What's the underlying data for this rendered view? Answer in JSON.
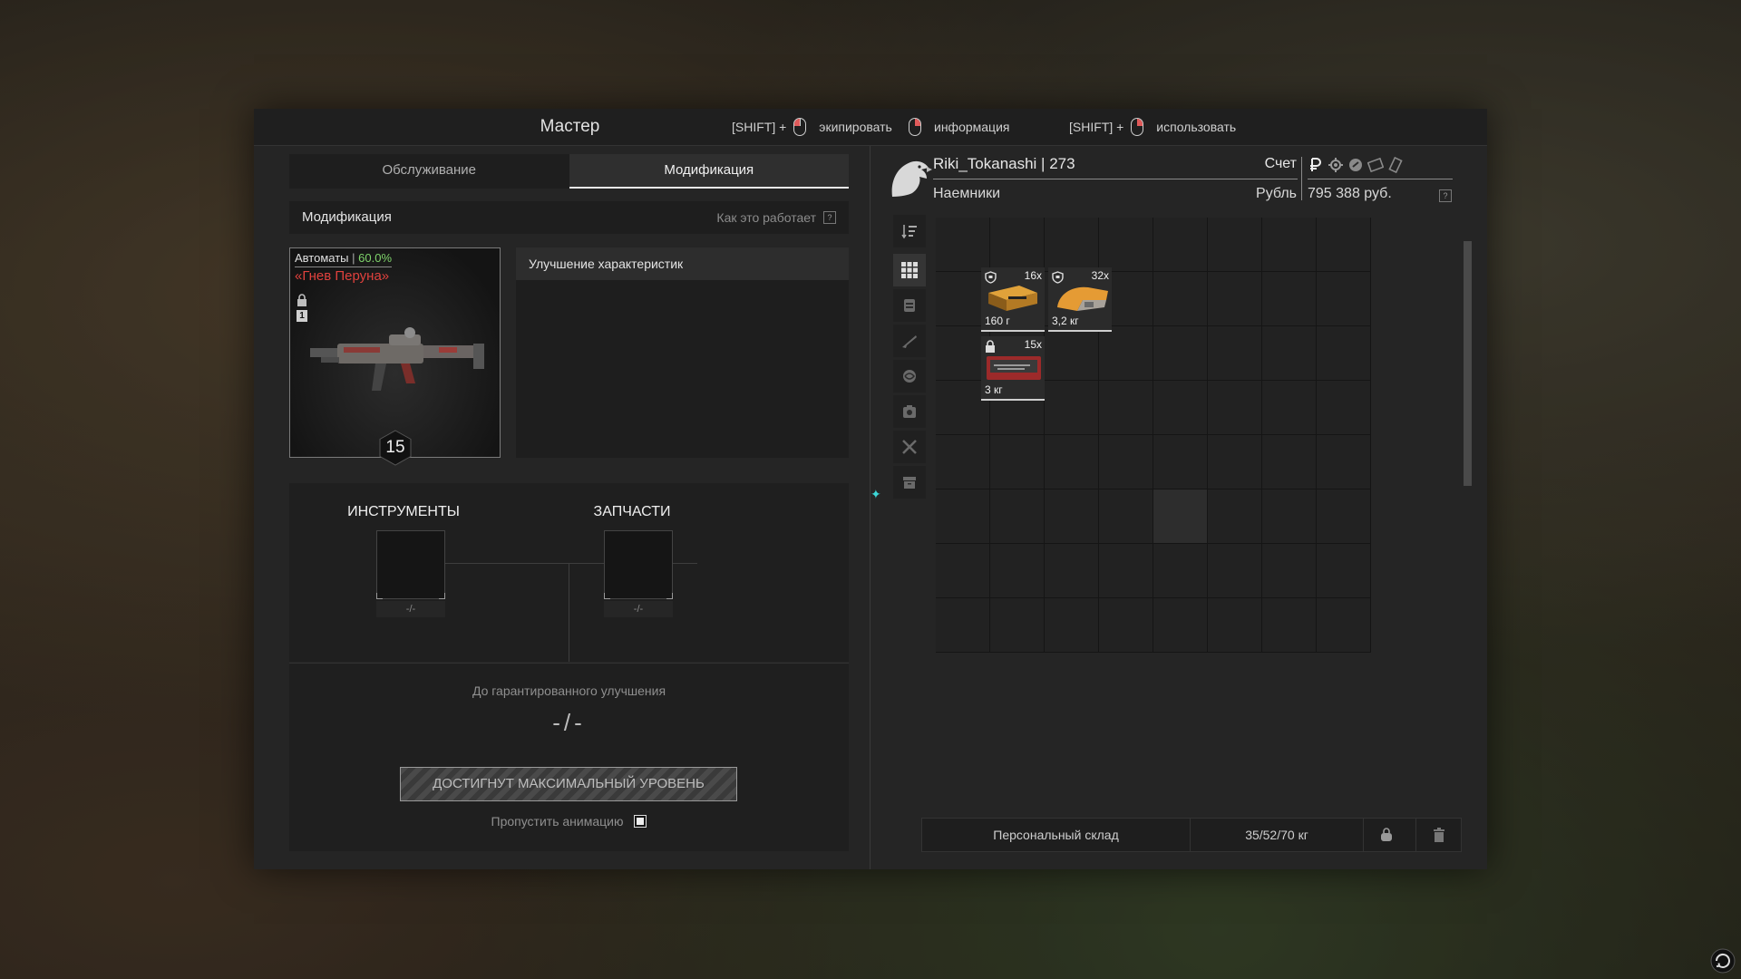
{
  "window": {
    "title": "Мастер",
    "hints": [
      {
        "prefix": "[SHIFT] +",
        "mouse": "left",
        "label": "экипировать"
      },
      {
        "prefix": "",
        "mouse": "right",
        "label": "информация"
      },
      {
        "prefix": "[SHIFT] +",
        "mouse": "right",
        "label": "использовать"
      }
    ]
  },
  "tabs": [
    {
      "label": "Обслуживание",
      "active": false
    },
    {
      "label": "Модификация",
      "active": true
    }
  ],
  "section": {
    "title": "Модификация",
    "how_it_works": "Как это работает",
    "help_mark": "?"
  },
  "weapon": {
    "category": "Автоматы",
    "separator": "|",
    "percent": "60.0%",
    "name": "«Гнев Перуна»",
    "badge": "1",
    "level": "15"
  },
  "stats": {
    "header": "Улучшение характеристик"
  },
  "requirements": {
    "tools_label": "ИНСТРУМЕНТЫ",
    "tools_value": "-/-",
    "parts_label": "ЗАПЧАСТИ",
    "parts_value": "-/-"
  },
  "guarantee": {
    "label": "До гарантированного улучшения",
    "value": "-/-"
  },
  "action": {
    "max_level_button": "ДОСТИГНУТ МАКСИМАЛЬНЫЙ УРОВЕНЬ",
    "skip_animation": "Пропустить анимацию",
    "skip_checked": true
  },
  "player": {
    "name": "Riki_Tokanashi | 273",
    "faction": "Наемники",
    "account_label": "Счет",
    "currency_label": "Рубль",
    "balance": "795 388 руб.",
    "currency_icons": [
      "ruble-icon",
      "gear-coin-icon",
      "badge-coin-icon",
      "ticket-icon",
      "voucher-icon"
    ]
  },
  "inventory": {
    "items": [
      {
        "name": "ammo-box-item",
        "qty": "16x",
        "weight": "160 г",
        "icon": "shield-icon"
      },
      {
        "name": "repair-kit-item",
        "qty": "32x",
        "weight": "3,2 кг",
        "icon": "shield-icon"
      },
      {
        "name": "toolbox-item",
        "qty": "15x",
        "weight": "3 кг",
        "icon": "lock-icon"
      }
    ],
    "stash_label": "Персональный склад",
    "weight": "35/52/70 кг"
  }
}
